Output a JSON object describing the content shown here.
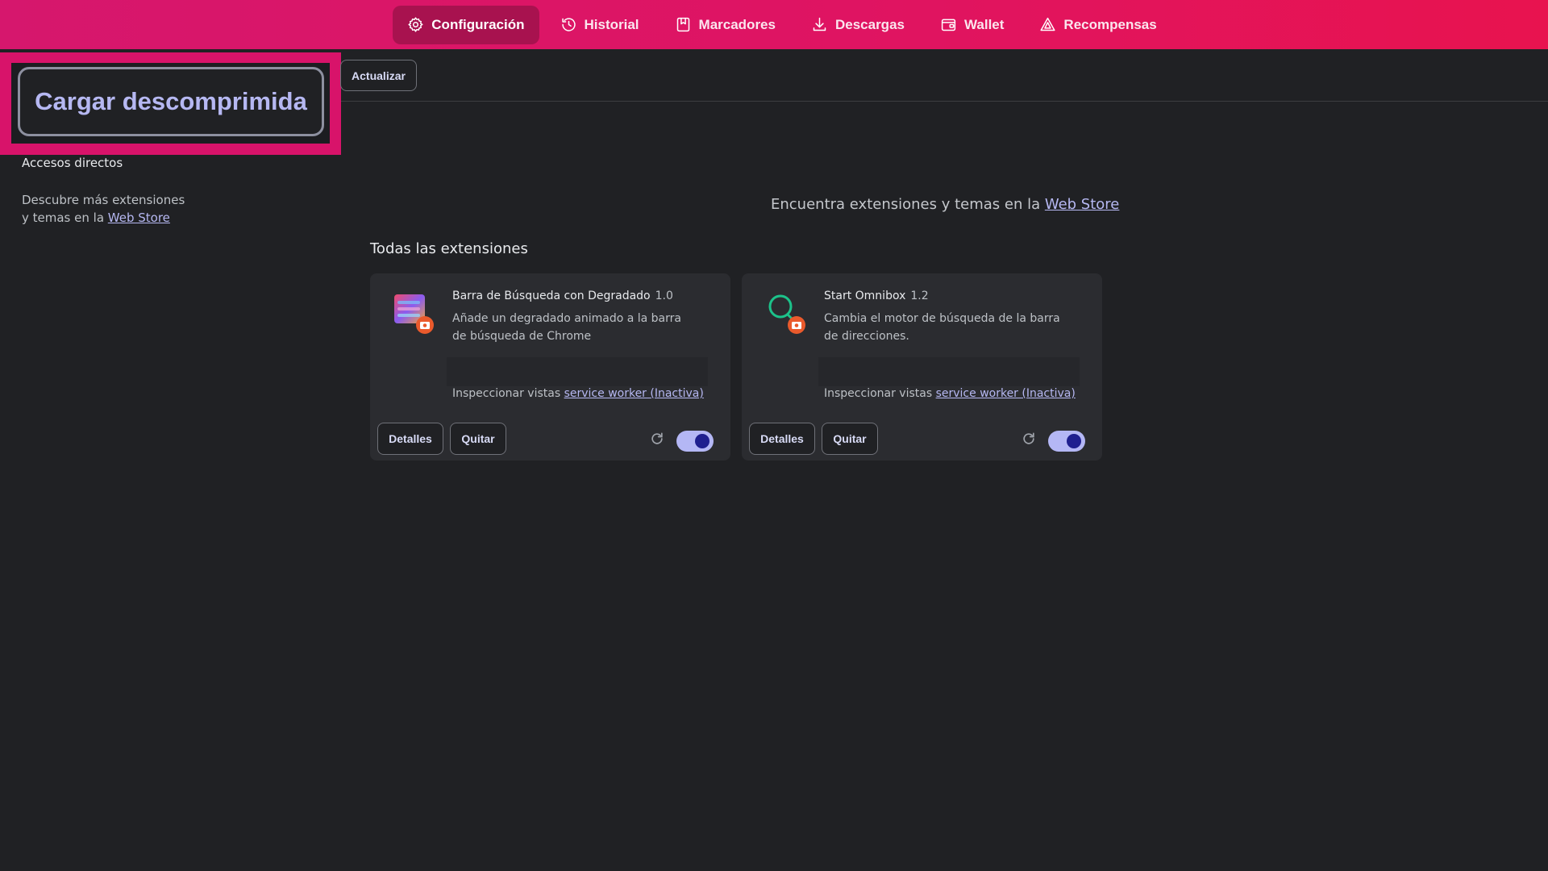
{
  "nav": {
    "items": [
      {
        "label": "Configuración",
        "icon": "gear-icon",
        "active": true
      },
      {
        "label": "Historial",
        "icon": "history-icon",
        "active": false
      },
      {
        "label": "Marcadores",
        "icon": "bookmark-icon",
        "active": false
      },
      {
        "label": "Descargas",
        "icon": "download-icon",
        "active": false
      },
      {
        "label": "Wallet",
        "icon": "wallet-icon",
        "active": false
      },
      {
        "label": "Recompensas",
        "icon": "rewards-triangle-icon",
        "active": false
      }
    ]
  },
  "toolbar": {
    "load_unpacked_label": "Cargar descomprimida",
    "update_label": "Actualizar"
  },
  "sidebar": {
    "shortcuts_label": "Accesos directos",
    "discover_text": "Descubre más extensiones y temas en la",
    "discover_link": "Web Store"
  },
  "main": {
    "store_text": "Encuentra extensiones y temas en la",
    "store_link": "Web Store",
    "section_title": "Todas las extensiones"
  },
  "extensions": [
    {
      "name": "Barra de Búsqueda con Degradado",
      "version": "1.0",
      "description": "Añade un degradado animado a la barra de búsqueda de Chrome",
      "inspect_label": "Inspeccionar vistas",
      "inspect_link": "service worker (Inactiva)",
      "details_label": "Detalles",
      "remove_label": "Quitar",
      "enabled": true,
      "icon": "gradient-bar-extension-icon"
    },
    {
      "name": "Start Omnibox",
      "version": "1.2",
      "description": "Cambia el motor de búsqueda de la barra de direcciones.",
      "inspect_label": "Inspeccionar vistas",
      "inspect_link": "service worker (Inactiva)",
      "details_label": "Detalles",
      "remove_label": "Quitar",
      "enabled": true,
      "icon": "omnibox-search-extension-icon"
    }
  ],
  "colors": {
    "accent": "#d6176d",
    "toggle_on": "#b4b7f5",
    "link": "#b6b8f2",
    "background": "#202124",
    "card": "#2b2c30"
  }
}
